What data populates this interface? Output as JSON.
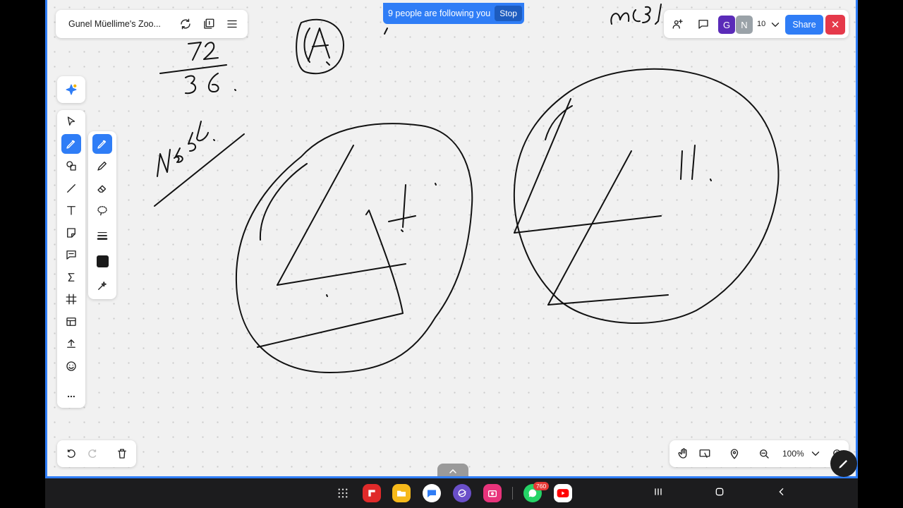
{
  "board": {
    "title": "Gunel Müellime's Zoo...",
    "follow_text": "9 people are following you",
    "stop_label": "Stop",
    "share_label": "Share",
    "close_label": "✕",
    "participant_count": "10",
    "avatars": [
      "G",
      "N"
    ],
    "zoom_level": "100%",
    "accent_color": "#2f7df6"
  },
  "left_toolbar": {
    "tools": [
      "select-icon",
      "pen-icon",
      "shapes-icon",
      "line-icon",
      "text-icon",
      "sticky-note-icon",
      "comment-icon",
      "formula-icon",
      "frame-icon",
      "template-icon",
      "upload-icon",
      "emoji-icon",
      "more-icon"
    ],
    "more_label": "..."
  },
  "pen_panel": {
    "tools": [
      "pen-icon",
      "pencil-icon",
      "eraser-icon",
      "lasso-icon",
      "stroke-width-icon",
      "color-swatch",
      "laser-pointer-icon"
    ],
    "selected_color": "#1a1a1a"
  },
  "handwriting": {
    "fraction_top": "72",
    "fraction_bottom": "36",
    "note_label": "N°55.",
    "circled_letter": "A",
    "top_right_scribble": "ω3,",
    "angle_label": "11."
  },
  "system_nav": {
    "notification_count": "760",
    "apps": [
      "apps-grid-icon",
      "flipboard-icon",
      "files-icon",
      "messages-icon",
      "internet-icon",
      "camera-icon",
      "whatsapp-icon",
      "youtube-icon"
    ]
  }
}
